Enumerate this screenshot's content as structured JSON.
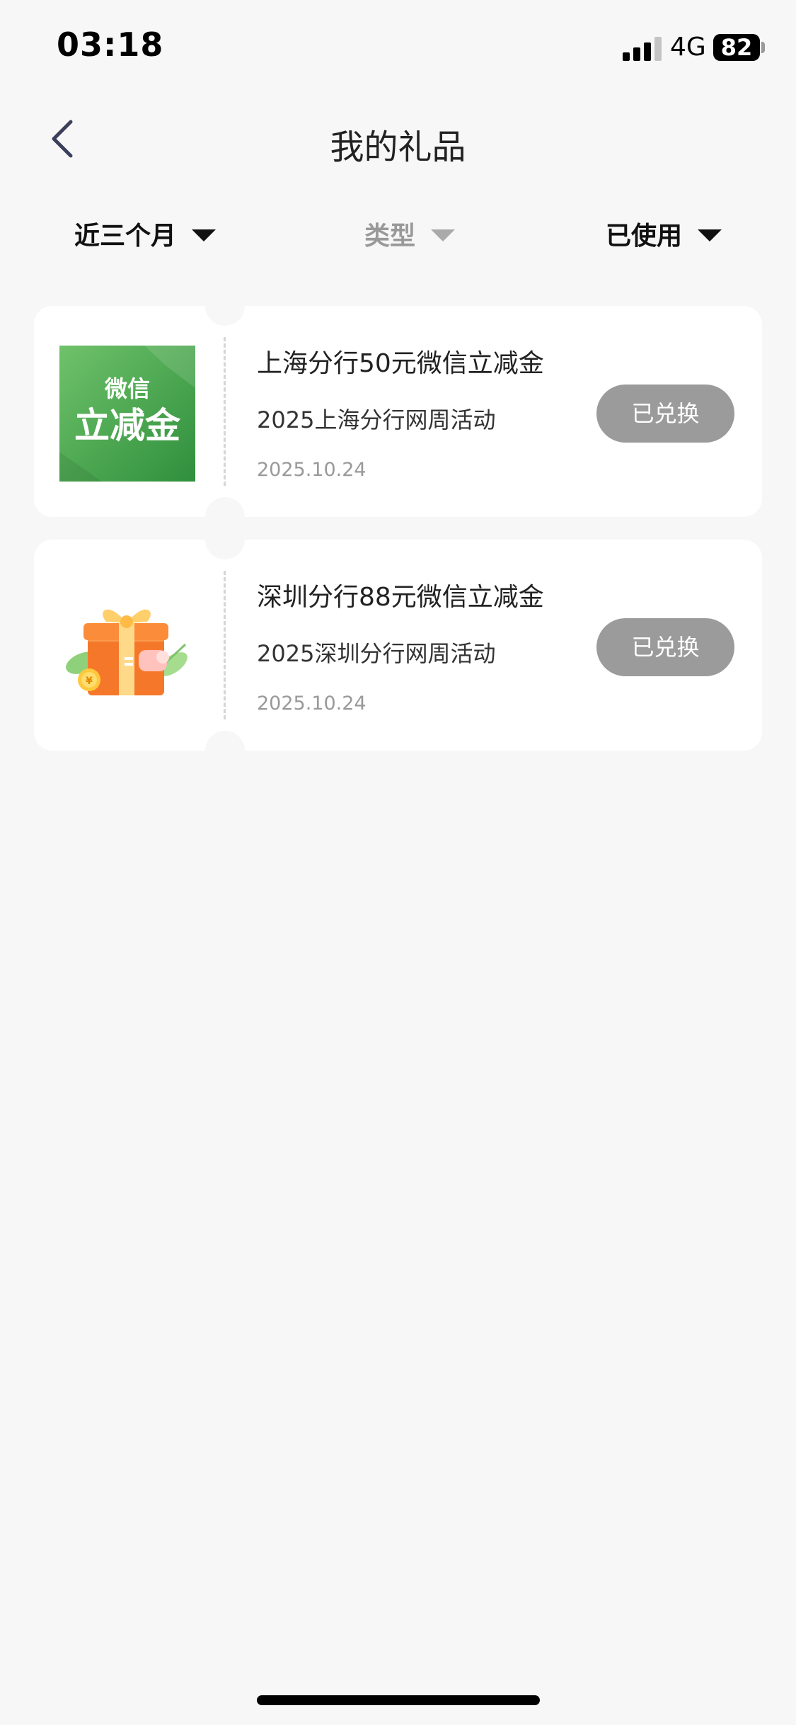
{
  "status_bar": {
    "time": "03:18",
    "network": "4G",
    "battery": "82",
    "signal_icon": "signal-bars-icon"
  },
  "nav": {
    "title": "我的礼品",
    "back_icon": "chevron-left-icon"
  },
  "filters": [
    {
      "label": "近三个月",
      "active": true
    },
    {
      "label": "类型",
      "active": false
    },
    {
      "label": "已使用",
      "active": true
    }
  ],
  "gifts": [
    {
      "name": "上海分行50元微信立减金",
      "activity": "2025上海分行网周活动",
      "date": "2025.10.24",
      "button": "已兑换",
      "thumb": {
        "line1": "微信",
        "line2": "立减金",
        "colors": [
          "#6fc26a",
          "#2f8f3c"
        ]
      }
    },
    {
      "name": "深圳分行88元微信立减金",
      "activity": "2025深圳分行网周活动",
      "date": "2025.10.24",
      "button": "已兑换",
      "thumb": {
        "icon": "gift-box-icon"
      }
    }
  ],
  "colors": {
    "background": "#f7f7f7",
    "card": "#ffffff",
    "button_disabled": "#9b9b9b"
  }
}
